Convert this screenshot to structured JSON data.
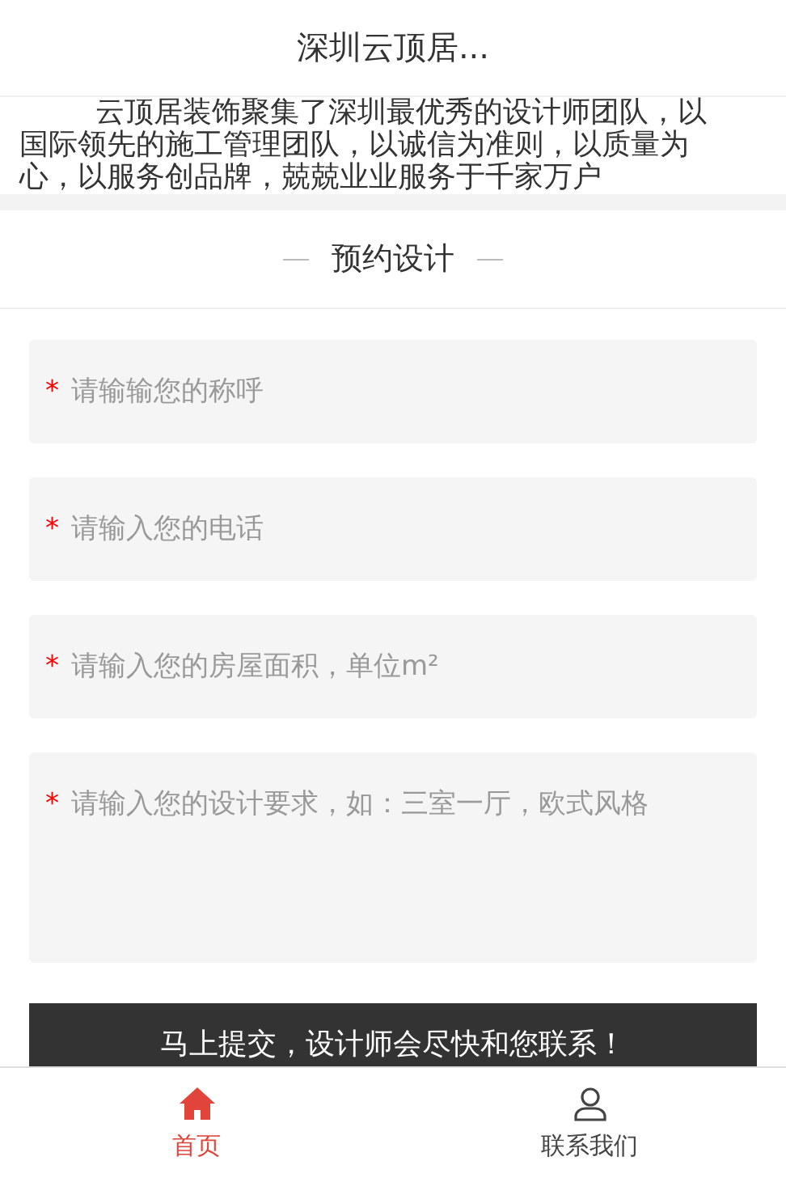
{
  "header": {
    "title": "深圳云顶居..."
  },
  "intro": {
    "lines": [
      "云顶居装饰聚集了深圳最优秀的设计师团队，以",
      "国际领先的施工管理团队，以诚信为准则，以质量为",
      "心，以服务创品牌，兢兢业业服务于千家万户"
    ]
  },
  "section": {
    "title": "预约设计"
  },
  "fields": [
    {
      "kind": "input",
      "required_mark": "*",
      "placeholder": "请输输您的称呼"
    },
    {
      "kind": "input",
      "required_mark": "*",
      "placeholder": "请输入您的电话"
    },
    {
      "kind": "input",
      "required_mark": "*",
      "placeholder": "请输入您的房屋面积，单位m²"
    },
    {
      "kind": "textarea",
      "required_mark": "*",
      "placeholder": "请输入您的设计要求，如：三室一厅，欧式风格"
    }
  ],
  "submit": {
    "label": "马上提交，设计师会尽快和您联系！"
  },
  "tabs": [
    {
      "kind": "home",
      "label": "首页",
      "selected": true
    },
    {
      "kind": "person",
      "label": "联系我们",
      "selected": false
    }
  ]
}
